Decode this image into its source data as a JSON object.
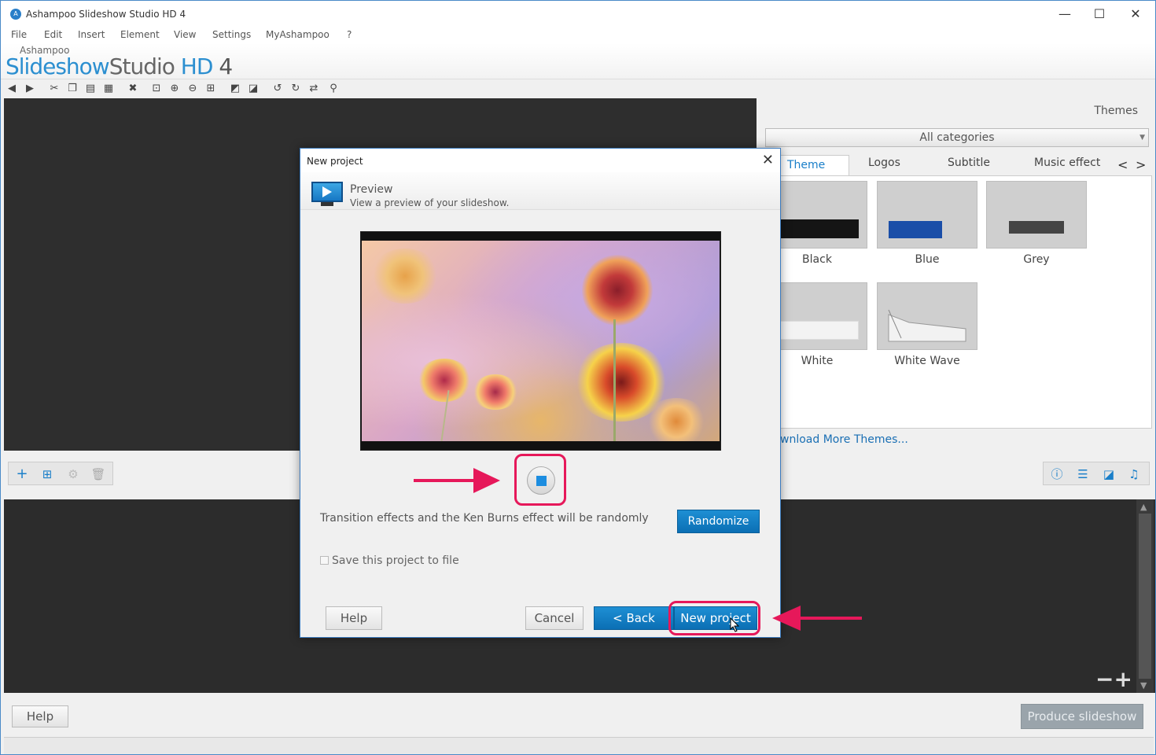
{
  "app": {
    "title": "Ashampoo Slideshow Studio HD 4",
    "brand_small": "Ashampoo",
    "brand_slideshow": "Slideshow",
    "brand_studio": "Studio",
    "brand_hd": " HD",
    "brand_num": "4"
  },
  "window_controls": {
    "minimize": "—",
    "maximize": "☐",
    "close": "✕"
  },
  "menu": [
    "File",
    "Edit",
    "Insert",
    "Element",
    "View",
    "Settings",
    "MyAshampoo",
    "?"
  ],
  "right_panel": {
    "title": "Themes",
    "category": "All categories",
    "tabs": [
      "Theme",
      "Logos",
      "Subtitle",
      "Music effect"
    ],
    "themes": [
      "Black",
      "Blue",
      "Grey",
      "White",
      "White Wave"
    ],
    "download_link": "wnload More Themes..."
  },
  "dialog": {
    "title": "New project",
    "close": "✕",
    "step_title": "Preview",
    "step_desc": "View a preview of your slideshow.",
    "random_text": "Transition effects and the Ken Burns effect will be randomly",
    "randomize_label": "Randomize",
    "save_label": "Save this project to file",
    "help_label": "Help",
    "cancel_label": "Cancel",
    "back_label": "< Back",
    "new_project_label": "New project"
  },
  "bottom": {
    "help_label": "Help",
    "produce_label": "Produce slideshow"
  },
  "colors": {
    "accent": "#1a7fc9",
    "highlight": "#e6185a"
  }
}
